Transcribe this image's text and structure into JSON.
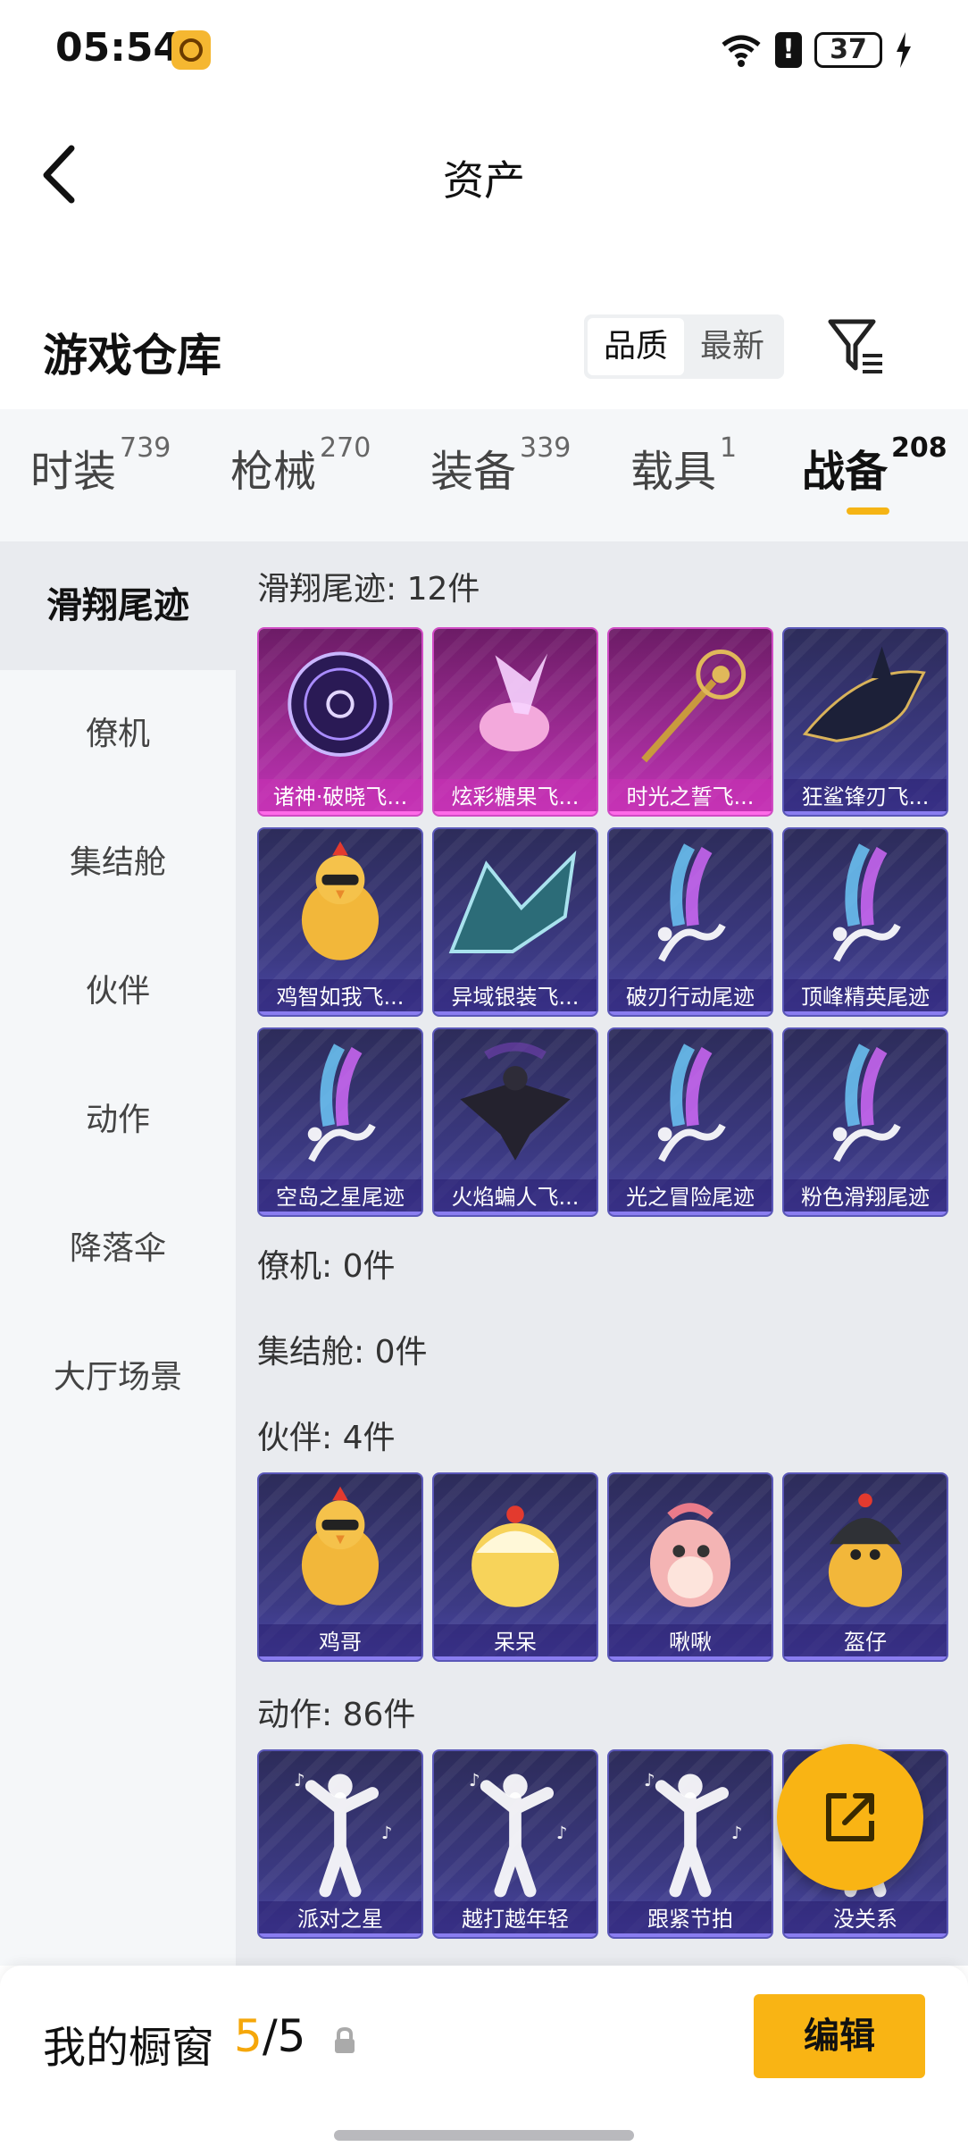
{
  "status_bar": {
    "time": "05:54",
    "battery": "37"
  },
  "header": {
    "title": "资产"
  },
  "section": {
    "title": "游戏仓库",
    "sort_options": [
      "品质",
      "最新"
    ],
    "sort_selected": "品质"
  },
  "tabs": [
    {
      "label": "时装",
      "count": "739"
    },
    {
      "label": "枪械",
      "count": "270"
    },
    {
      "label": "装备",
      "count": "339"
    },
    {
      "label": "载具",
      "count": "1"
    },
    {
      "label": "战备",
      "count": "208",
      "active": true
    }
  ],
  "sidebar": [
    {
      "label": "滑翔尾迹",
      "active": true
    },
    {
      "label": "僚机"
    },
    {
      "label": "集结舱"
    },
    {
      "label": "伙伴"
    },
    {
      "label": "动作"
    },
    {
      "label": "降落伞"
    },
    {
      "label": "大厅场景"
    }
  ],
  "categories": {
    "glide": {
      "title": "滑翔尾迹: 12件",
      "items": [
        {
          "name": "诸神·破晓飞...",
          "rarity": "pink",
          "icon": "magic-circle-icon"
        },
        {
          "name": "炫彩糖果飞...",
          "rarity": "pink",
          "icon": "candy-icon"
        },
        {
          "name": "时光之誓飞...",
          "rarity": "pink",
          "icon": "scepter-icon"
        },
        {
          "name": "狂鲨锋刃飞...",
          "rarity": "purple",
          "icon": "shark-icon"
        },
        {
          "name": "鸡智如我飞...",
          "rarity": "purple",
          "icon": "chicken-icon"
        },
        {
          "name": "异域银装飞...",
          "rarity": "purple",
          "icon": "wing-icon"
        },
        {
          "name": "破刃行动尾迹",
          "rarity": "purple",
          "icon": "smoke-trail-icon"
        },
        {
          "name": "顶峰精英尾迹",
          "rarity": "purple",
          "icon": "smoke-trail-icon"
        },
        {
          "name": "空岛之星尾迹",
          "rarity": "purple",
          "icon": "smoke-trail-icon"
        },
        {
          "name": "火焰蝙人飞...",
          "rarity": "purple",
          "icon": "wingsuit-icon"
        },
        {
          "name": "光之冒险尾迹",
          "rarity": "purple",
          "icon": "smoke-trail-icon"
        },
        {
          "name": "粉色滑翔尾迹",
          "rarity": "purple",
          "icon": "smoke-trail-icon"
        }
      ]
    },
    "wingman": {
      "title": "僚机: 0件"
    },
    "pod": {
      "title": "集结舱: 0件"
    },
    "companion": {
      "title": "伙伴: 4件",
      "items": [
        {
          "name": "鸡哥",
          "icon": "chicken-icon"
        },
        {
          "name": "呆呆",
          "icon": "chick-icon"
        },
        {
          "name": "啾啾",
          "icon": "bird-icon"
        },
        {
          "name": "盔仔",
          "icon": "helmet-chick-icon"
        }
      ]
    },
    "emote": {
      "title": "动作: 86件",
      "items": [
        {
          "name": "派对之星",
          "icon": "dancer-icon"
        },
        {
          "name": "越打越年轻",
          "icon": "dancer-icon"
        },
        {
          "name": "跟紧节拍",
          "icon": "dancer-icon"
        },
        {
          "name": "没关系",
          "icon": "dancer-icon"
        }
      ]
    }
  },
  "bottom_bar": {
    "label": "我的橱窗",
    "current": "5",
    "total": "/5",
    "edit_label": "编辑"
  },
  "colors": {
    "accent": "#f9b414",
    "pink_rarity": "#c233b7",
    "purple_rarity": "#3c3a84"
  }
}
